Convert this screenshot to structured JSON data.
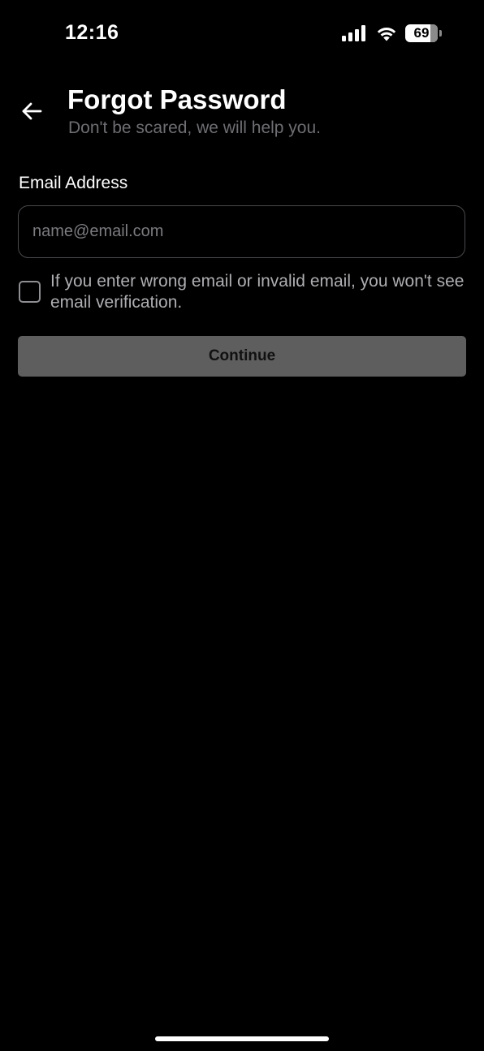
{
  "status_bar": {
    "time": "12:16",
    "battery_level": "69",
    "icons": [
      "signal-icon",
      "wifi-icon",
      "battery-icon"
    ]
  },
  "header": {
    "back_icon": "arrow-left-icon",
    "title": "Forgot Password",
    "subtitle": "Don't be scared, we will help you."
  },
  "form": {
    "email_label": "Email Address",
    "email_value": "",
    "email_placeholder": "name@email.com",
    "checkbox_checked": false,
    "checkbox_text": "If you enter wrong email or invalid email, you won't see email verification.",
    "continue_label": "Continue"
  },
  "colors": {
    "background": "#000000",
    "text_primary": "#ffffff",
    "text_secondary": "#6e6e73",
    "button_disabled": "#5e5e5e",
    "input_border": "#4a4a4e"
  }
}
